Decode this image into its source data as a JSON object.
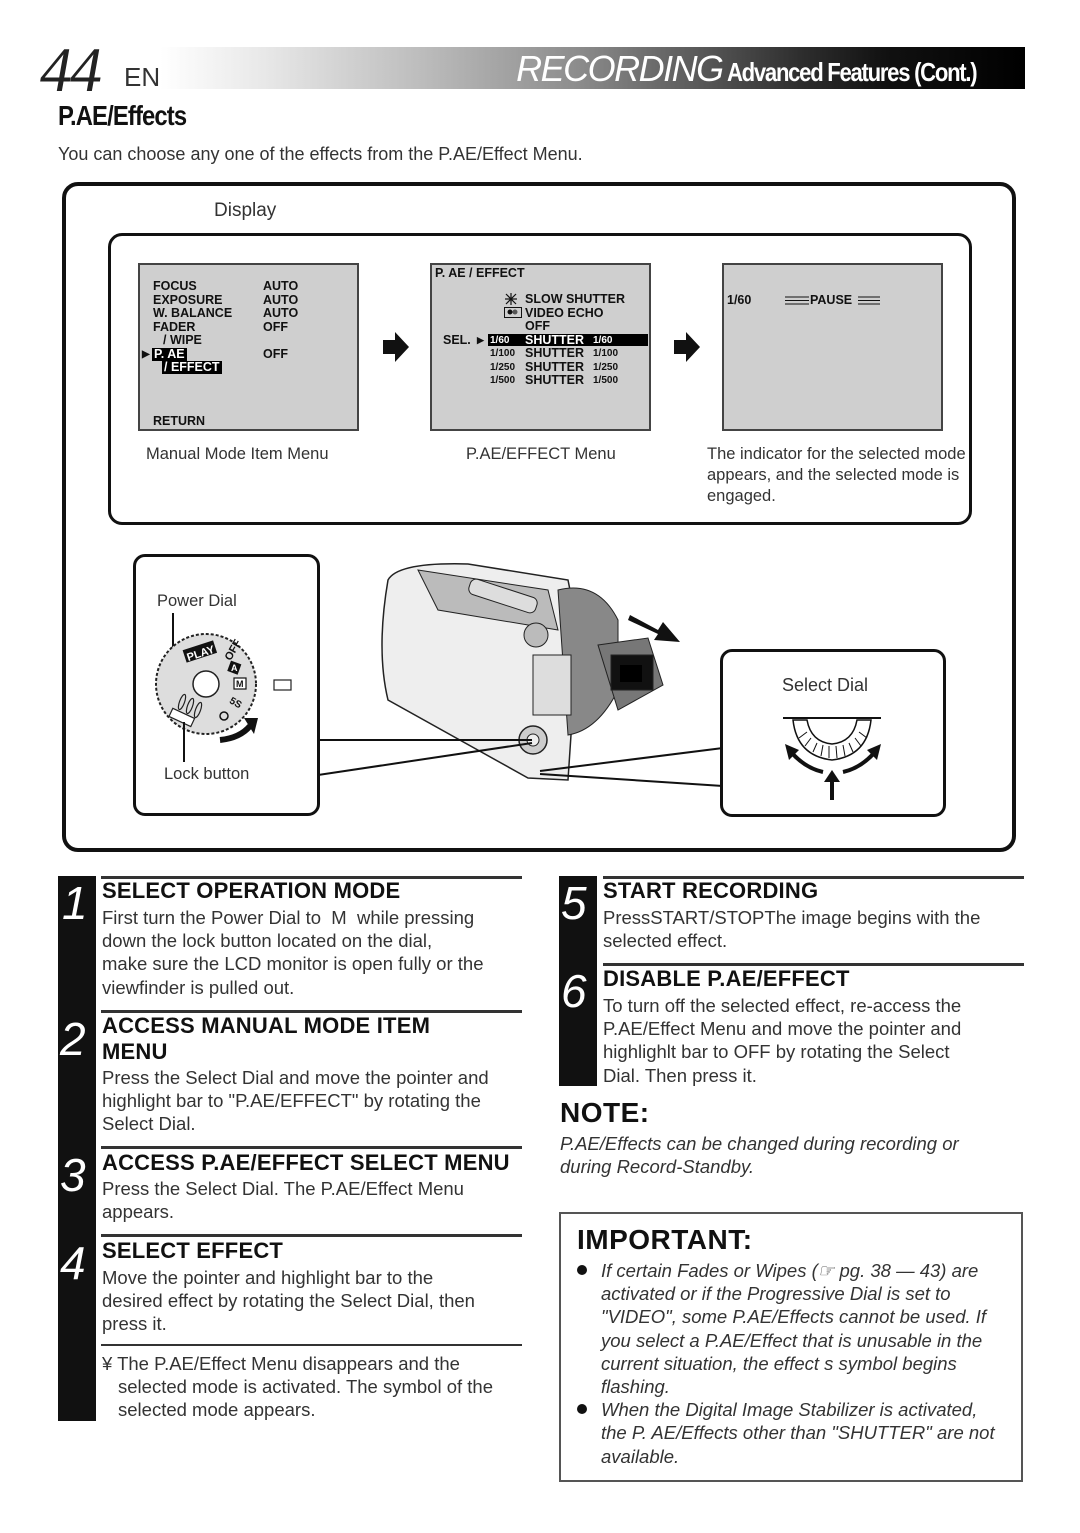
{
  "header": {
    "page_number": "44",
    "language": "EN",
    "section": "RECORDING",
    "subsection": "Advanced Features (Cont.)"
  },
  "title": "P.AE/Effects",
  "intro": "You can choose any one of the effects from the P.AE/Effect Menu.",
  "display": {
    "label": "Display",
    "screens": [
      {
        "caption": "Manual Mode Item Menu",
        "rows": [
          {
            "item": "FOCUS",
            "value": "AUTO"
          },
          {
            "item": "EXPOSURE",
            "value": "AUTO"
          },
          {
            "item": "W. BALANCE",
            "value": "AUTO"
          },
          {
            "item": "FADER",
            "value": "OFF"
          },
          {
            "item": "/ WIPE",
            "value": ""
          },
          {
            "item": "P. AE",
            "value": "OFF"
          },
          {
            "item": "/ EFFECT",
            "value": ""
          }
        ],
        "selected_item": "P. AE / EFFECT",
        "return_label": "RETURN"
      },
      {
        "caption": "P.AE/EFFECT Menu",
        "title": "P. AE / EFFECT",
        "sel_label": "SEL.",
        "rows": [
          {
            "icon": "slow-shutter-icon",
            "prefix": "",
            "label": "SLOW SHUTTER",
            "suffix": ""
          },
          {
            "icon": "video-echo-icon",
            "prefix": "",
            "label": "VIDEO ECHO",
            "suffix": ""
          },
          {
            "icon": "",
            "prefix": "",
            "label": "OFF",
            "suffix": ""
          },
          {
            "icon": "",
            "prefix": "1/60",
            "label": "SHUTTER",
            "suffix": "1/60"
          },
          {
            "icon": "",
            "prefix": "1/100",
            "label": "SHUTTER",
            "suffix": "1/100"
          },
          {
            "icon": "",
            "prefix": "1/250",
            "label": "SHUTTER",
            "suffix": "1/250"
          },
          {
            "icon": "",
            "prefix": "1/500",
            "label": "SHUTTER",
            "suffix": "1/500"
          }
        ],
        "selected_index": 3
      },
      {
        "caption": "The indicator for the selected mode appears, and the selected mode is engaged.",
        "indicator": "1/60",
        "status": "PAUSE"
      }
    ]
  },
  "illustration": {
    "power_dial_label": "Power Dial",
    "lock_button_label": "Lock button",
    "select_dial_label": "Select Dial",
    "dial_marks": [
      "PLAY",
      "OFF",
      "A",
      "M",
      "5S"
    ]
  },
  "steps": [
    {
      "number": "1",
      "title": "SELECT OPERATION MODE",
      "lines": [
        "First turn the Power Dial to  M  while pressing",
        "down the lock button located on the dial,",
        "make sure the LCD monitor is open fully or the",
        "viewfinder is pulled out."
      ]
    },
    {
      "number": "2",
      "title": "ACCESS MANUAL MODE ITEM",
      "title2": "MENU",
      "lines": [
        "Press the Select Dial and move the pointer and",
        "highlight bar to \"P.AE/EFFECT\" by rotating the",
        "Select Dial."
      ]
    },
    {
      "number": "3",
      "title": "ACCESS P.AE/EFFECT SELECT MENU",
      "lines": [
        "Press the Select Dial. The P.AE/Effect Menu",
        "appears."
      ]
    },
    {
      "number": "4",
      "title": "SELECT EFFECT",
      "lines": [
        "Move the pointer and highlight bar to the",
        "desired effect by rotating the Select Dial, then",
        "press it."
      ],
      "note_lines": [
        "¥ The P.AE/Effect Menu disappears and the",
        "selected mode is activated. The symbol of the",
        "selected mode appears."
      ]
    },
    {
      "number": "5",
      "title": "START RECORDING",
      "lines": [
        "PressSTART/STOPThe image begins with the",
        "selected effect."
      ]
    },
    {
      "number": "6",
      "title": "DISABLE P.AE/EFFECT",
      "lines": [
        "To turn off the selected effect, re-access the",
        "P.AE/Effect Menu and move the pointer and",
        "highlighlt bar to  OFF  by rotating the Select",
        "Dial. Then press it."
      ]
    }
  ],
  "note": {
    "title": "NOTE:",
    "lines": [
      "P.AE/Effects can be changed during recording or",
      "during Record-Standby."
    ]
  },
  "important": {
    "title": "IMPORTANT:",
    "bullets": [
      [
        "If certain Fades or Wipes (☞ pg. 38 — 43) are",
        "activated or if the Progressive Dial is set to",
        "\"VIDEO\", some P.AE/Effects cannot be used. If",
        "you select a P.AE/Effect that is unusable in the",
        "current situation, the effect s symbol begins",
        "flashing."
      ],
      [
        "When the Digital Image Stabilizer is activated,",
        "the P. AE/Effects other than \"SHUTTER\" are not",
        "available."
      ]
    ]
  }
}
